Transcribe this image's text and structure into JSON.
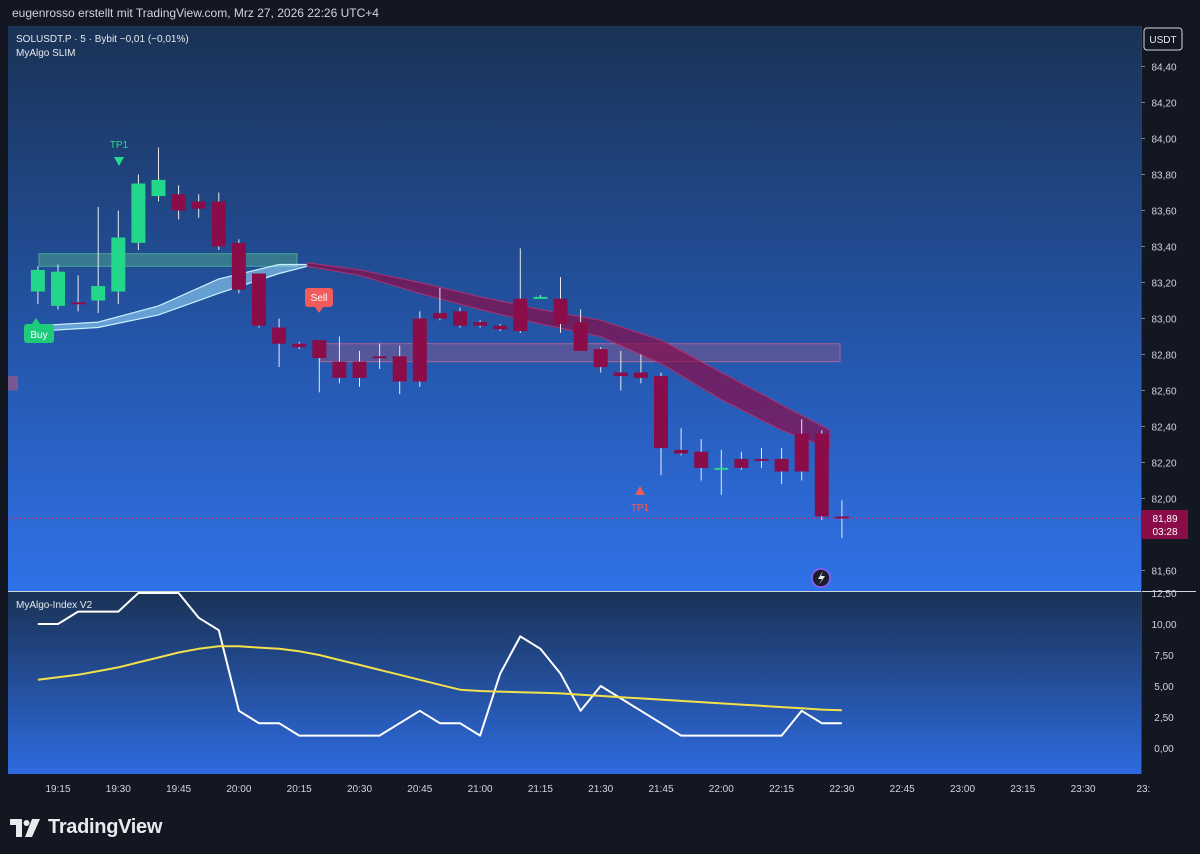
{
  "header": {
    "attribution": "eugenrosso erstellt mit TradingView.com, Mrz 27, 2026 22:26 UTC+4"
  },
  "legend": {
    "symbol_line": "SOLUSDT.P · 5 · Bybit  −0,01 (−0,01%)",
    "indicator": "MyAlgo SLIM",
    "sub_indicator": "MyAlgo-Index V2"
  },
  "currency_badge": "USDT",
  "price_label": {
    "price": "81,89",
    "countdown": "03:28"
  },
  "signals": {
    "buy": "Buy",
    "sell": "Sell",
    "tp_top": "TP1",
    "tp_bottom": "TP1"
  },
  "footer": {
    "brand": "TradingView"
  },
  "colors": {
    "bull": "#22d68a",
    "bear": "#8a0c48",
    "index_line": "#ffffff",
    "signal_line": "#f2e14a",
    "sell_badge": "#f25b5b",
    "buy_badge": "#1ecb7a"
  },
  "chart_data": [
    {
      "type": "candlestick",
      "title": "SOLUSDT.P · 5 · Bybit",
      "x_ticks": [
        "19:15",
        "19:30",
        "19:45",
        "20:00",
        "20:15",
        "20:30",
        "20:45",
        "21:00",
        "21:15",
        "21:30",
        "21:45",
        "22:00",
        "22:15",
        "22:30",
        "22:45",
        "23:00",
        "23:15",
        "23:30",
        "23:"
      ],
      "y_ticks": [
        "84,40",
        "84,20",
        "84,00",
        "83,80",
        "83,60",
        "83,40",
        "83,20",
        "83,00",
        "82,80",
        "82,60",
        "82,40",
        "82,20",
        "82,00",
        "81,60"
      ],
      "ylim": [
        81.45,
        84.55
      ],
      "last_price": 81.89,
      "candles": [
        {
          "t": "19:10",
          "o": 83.15,
          "h": 83.29,
          "l": 83.08,
          "c": 83.27
        },
        {
          "t": "19:15",
          "o": 83.07,
          "h": 83.3,
          "l": 83.05,
          "c": 83.26
        },
        {
          "t": "19:20",
          "o": 83.09,
          "h": 83.24,
          "l": 83.04,
          "c": 83.08
        },
        {
          "t": "19:25",
          "o": 83.1,
          "h": 83.62,
          "l": 83.03,
          "c": 83.18
        },
        {
          "t": "19:30",
          "o": 83.15,
          "h": 83.6,
          "l": 83.08,
          "c": 83.45
        },
        {
          "t": "19:35",
          "o": 83.42,
          "h": 83.8,
          "l": 83.38,
          "c": 83.75
        },
        {
          "t": "19:40",
          "o": 83.68,
          "h": 83.95,
          "l": 83.65,
          "c": 83.77
        },
        {
          "t": "19:45",
          "o": 83.69,
          "h": 83.74,
          "l": 83.55,
          "c": 83.6
        },
        {
          "t": "19:50",
          "o": 83.65,
          "h": 83.69,
          "l": 83.56,
          "c": 83.61
        },
        {
          "t": "19:55",
          "o": 83.65,
          "h": 83.7,
          "l": 83.38,
          "c": 83.4
        },
        {
          "t": "20:00",
          "o": 83.42,
          "h": 83.44,
          "l": 83.14,
          "c": 83.16
        },
        {
          "t": "20:05",
          "o": 83.25,
          "h": 83.25,
          "l": 82.95,
          "c": 82.96
        },
        {
          "t": "20:10",
          "o": 82.95,
          "h": 83.0,
          "l": 82.73,
          "c": 82.86
        },
        {
          "t": "20:15",
          "o": 82.86,
          "h": 82.87,
          "l": 82.83,
          "c": 82.84
        },
        {
          "t": "20:20",
          "o": 82.88,
          "h": 82.88,
          "l": 82.59,
          "c": 82.78
        },
        {
          "t": "20:25",
          "o": 82.76,
          "h": 82.9,
          "l": 82.64,
          "c": 82.67
        },
        {
          "t": "20:30",
          "o": 82.76,
          "h": 82.82,
          "l": 82.62,
          "c": 82.67
        },
        {
          "t": "20:35",
          "o": 82.79,
          "h": 82.86,
          "l": 82.72,
          "c": 82.78
        },
        {
          "t": "20:40",
          "o": 82.79,
          "h": 82.85,
          "l": 82.58,
          "c": 82.65
        },
        {
          "t": "20:45",
          "o": 83.0,
          "h": 83.04,
          "l": 82.62,
          "c": 82.65
        },
        {
          "t": "20:50",
          "o": 83.03,
          "h": 83.17,
          "l": 82.99,
          "c": 83.0
        },
        {
          "t": "20:55",
          "o": 83.04,
          "h": 83.06,
          "l": 82.95,
          "c": 82.96
        },
        {
          "t": "21:00",
          "o": 82.98,
          "h": 82.99,
          "l": 82.95,
          "c": 82.96
        },
        {
          "t": "21:05",
          "o": 82.96,
          "h": 82.97,
          "l": 82.93,
          "c": 82.94
        },
        {
          "t": "21:10",
          "o": 83.11,
          "h": 83.39,
          "l": 82.92,
          "c": 82.93
        },
        {
          "t": "21:15",
          "o": 83.12,
          "h": 83.13,
          "l": 83.11,
          "c": 83.12
        },
        {
          "t": "21:20",
          "o": 83.11,
          "h": 83.23,
          "l": 82.92,
          "c": 82.97
        },
        {
          "t": "21:25",
          "o": 82.98,
          "h": 83.05,
          "l": 82.82,
          "c": 82.82
        },
        {
          "t": "21:30",
          "o": 82.83,
          "h": 82.84,
          "l": 82.7,
          "c": 82.73
        },
        {
          "t": "21:35",
          "o": 82.7,
          "h": 82.82,
          "l": 82.6,
          "c": 82.68
        },
        {
          "t": "21:40",
          "o": 82.7,
          "h": 82.8,
          "l": 82.64,
          "c": 82.67
        },
        {
          "t": "21:45",
          "o": 82.68,
          "h": 82.7,
          "l": 82.13,
          "c": 82.28
        },
        {
          "t": "21:50",
          "o": 82.27,
          "h": 82.39,
          "l": 82.24,
          "c": 82.25
        },
        {
          "t": "21:55",
          "o": 82.26,
          "h": 82.33,
          "l": 82.1,
          "c": 82.17
        },
        {
          "t": "22:00",
          "o": 82.17,
          "h": 82.27,
          "l": 82.02,
          "c": 82.17
        },
        {
          "t": "22:05",
          "o": 82.22,
          "h": 82.26,
          "l": 82.16,
          "c": 82.17
        },
        {
          "t": "22:10",
          "o": 82.22,
          "h": 82.28,
          "l": 82.17,
          "c": 82.21
        },
        {
          "t": "22:15",
          "o": 82.22,
          "h": 82.28,
          "l": 82.08,
          "c": 82.15
        },
        {
          "t": "22:20",
          "o": 82.36,
          "h": 82.44,
          "l": 82.1,
          "c": 82.15
        },
        {
          "t": "22:25",
          "o": 82.36,
          "h": 82.38,
          "l": 81.88,
          "c": 81.9
        },
        {
          "t": "22:30",
          "o": 81.9,
          "h": 81.99,
          "l": 81.78,
          "c": 81.89
        }
      ]
    },
    {
      "type": "line",
      "title": "MyAlgo-Index V2",
      "y_ticks": [
        "12,50",
        "10,00",
        "7,50",
        "5,00",
        "2,50",
        "0,00"
      ],
      "ylim": [
        -1.2,
        12.6
      ],
      "x": [
        "19:10",
        "19:15",
        "19:20",
        "19:25",
        "19:30",
        "19:35",
        "19:40",
        "19:45",
        "19:50",
        "19:55",
        "20:00",
        "20:05",
        "20:10",
        "20:15",
        "20:20",
        "20:25",
        "20:30",
        "20:35",
        "20:40",
        "20:45",
        "20:50",
        "20:55",
        "21:00",
        "21:05",
        "21:10",
        "21:15",
        "21:20",
        "21:25",
        "21:30",
        "21:35",
        "21:40",
        "21:45",
        "21:50",
        "21:55",
        "22:00",
        "22:05",
        "22:10",
        "22:15",
        "22:20",
        "22:25",
        "22:30"
      ],
      "series": [
        {
          "name": "",
          "values": [
            10,
            10,
            11,
            11,
            11,
            12.5,
            12.5,
            12.5,
            10.5,
            9.5,
            3,
            2,
            2,
            1,
            1,
            1,
            1,
            1,
            2,
            3,
            2,
            2,
            1,
            6,
            9,
            8,
            6,
            3,
            5,
            4,
            3,
            2,
            1,
            1,
            1,
            1,
            1,
            1,
            3,
            2,
            2
          ]
        },
        {
          "name": "",
          "values": [
            5.5,
            5.7,
            5.9,
            6.2,
            6.5,
            6.9,
            7.3,
            7.7,
            8.0,
            8.2,
            8.2,
            8.1,
            8.0,
            7.8,
            7.5,
            7.1,
            6.7,
            6.3,
            5.9,
            5.5,
            5.1,
            4.7,
            4.6,
            4.55,
            4.5,
            4.45,
            4.4,
            4.3,
            4.2,
            4.1,
            4.0,
            3.9,
            3.8,
            3.7,
            3.6,
            3.5,
            3.4,
            3.3,
            3.2,
            3.1,
            3.05
          ]
        }
      ]
    }
  ]
}
